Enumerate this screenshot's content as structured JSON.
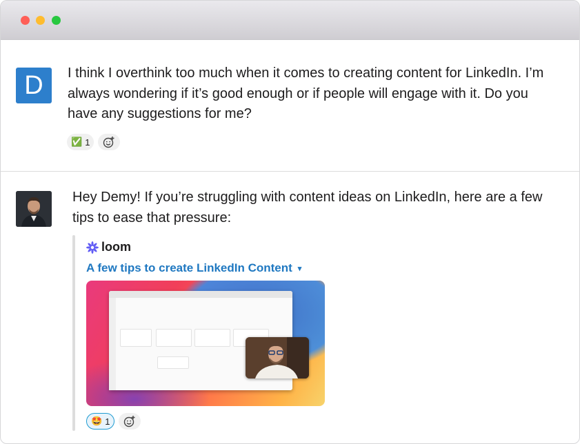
{
  "window": {
    "controls": [
      "close",
      "minimize",
      "maximize"
    ]
  },
  "message1": {
    "avatar_letter": "D",
    "text": "I think I overthink too much when it comes to creating content for LinkedIn. I’m always wondering if it’s good enough or if people will engage with it. Do you have any suggestions for me?",
    "reaction": {
      "emoji": "✅",
      "count": "1"
    }
  },
  "message2": {
    "text": "Hey Demy! If you’re struggling with content ideas on LinkedIn, here are a few tips to ease that pressure:",
    "attachment": {
      "brand": "loom",
      "title": "A few tips to create LinkedIn Content",
      "caret": "▾"
    },
    "reaction": {
      "emoji": "🤩",
      "count": "1"
    }
  },
  "colors": {
    "accent": "#1f78c1",
    "avatar_bg": "#2d7fcc",
    "reaction_active": "#1d9bd1"
  }
}
